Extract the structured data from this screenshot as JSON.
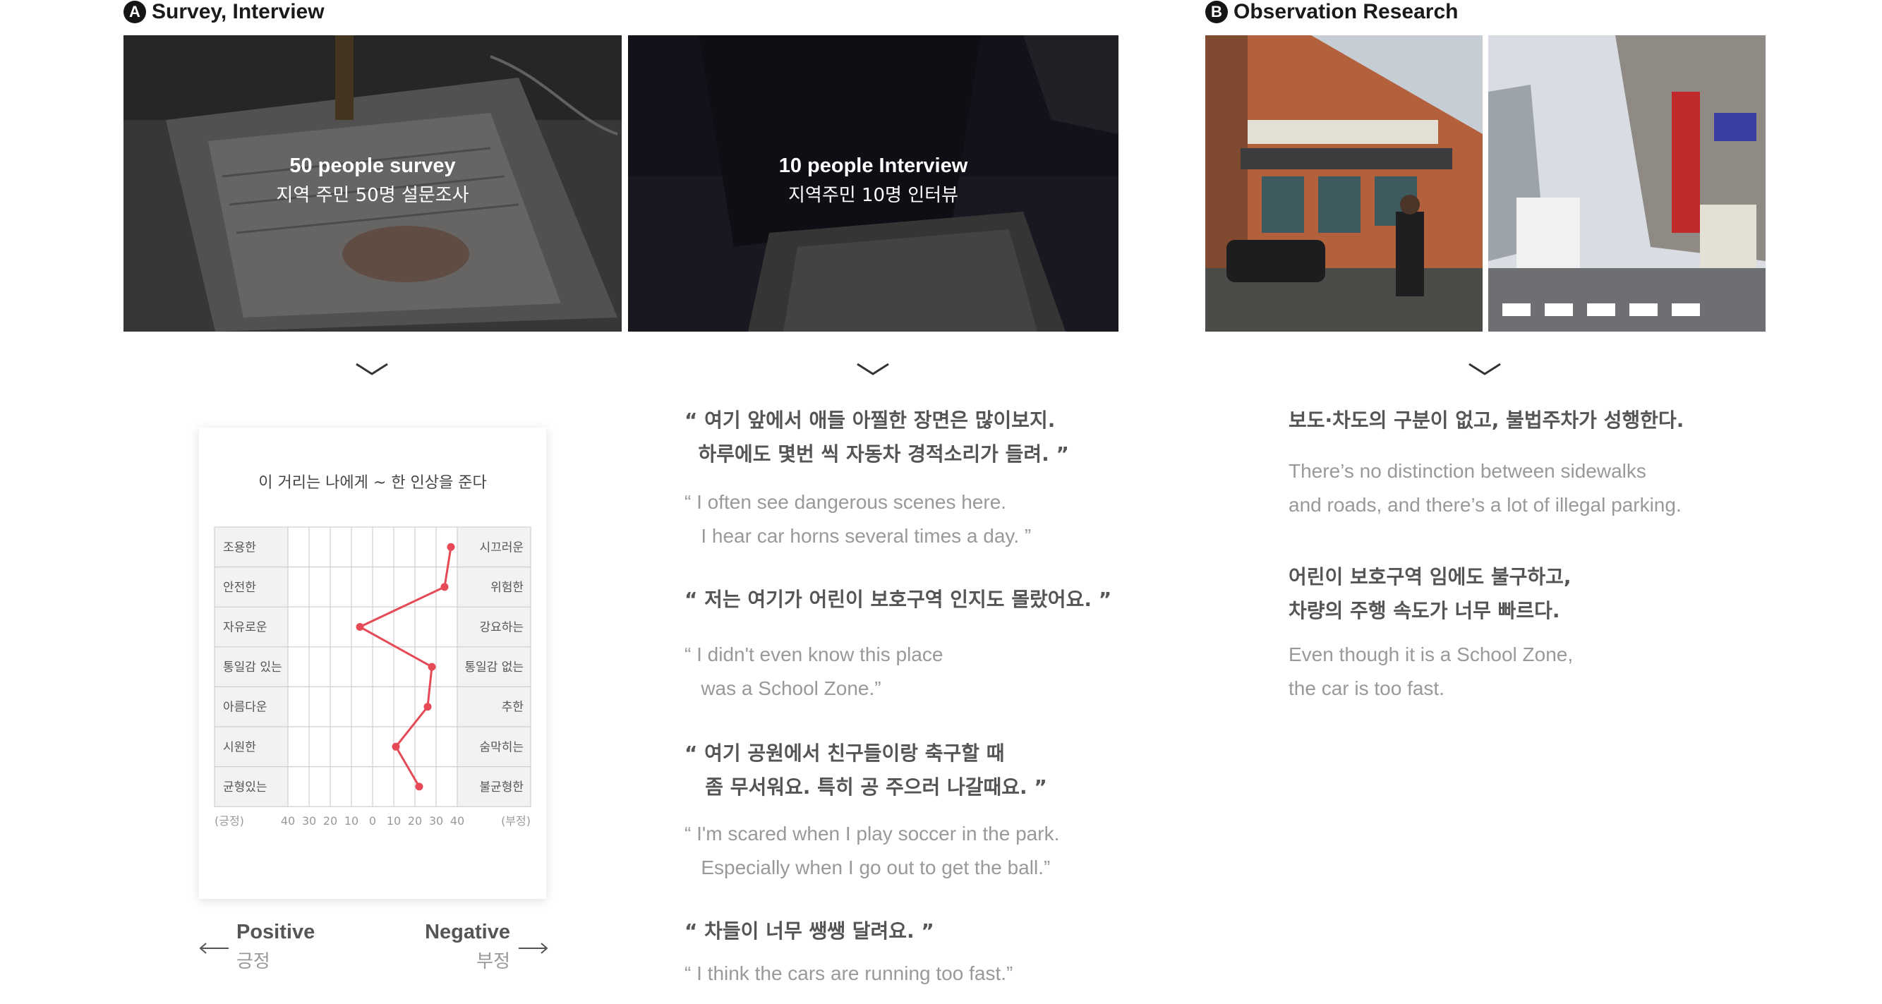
{
  "sections": {
    "a": {
      "badge": "A",
      "title": "Survey, Interview"
    },
    "b": {
      "badge": "B",
      "title": "Observation Research"
    }
  },
  "photos": {
    "survey": {
      "title": "50 people survey",
      "subtitle": "지역 주민 50명 설문조사"
    },
    "interview": {
      "title": "10 people Interview",
      "subtitle": "지역주민 10명 인터뷰"
    }
  },
  "chart_data": {
    "type": "line",
    "title": "이 거리는 나에게 ~ 한 인상을 준다",
    "left_labels": [
      "조용한",
      "안전한",
      "자유로운",
      "통일감 있는",
      "아름다운",
      "시원한",
      "균형있는"
    ],
    "right_labels": [
      "시끄러운",
      "위험한",
      "강요하는",
      "통일감 없는",
      "추한",
      "숨막히는",
      "불균형한"
    ],
    "x_ticks": [
      "40",
      "30",
      "20",
      "10",
      "0",
      "10",
      "20",
      "30",
      "40"
    ],
    "x_left_caption": "(긍정)",
    "x_right_caption": "(부정)",
    "xlim": [
      -40,
      40
    ],
    "values": [
      37,
      34,
      -6,
      28,
      26,
      11,
      22
    ],
    "color": "#e64a57"
  },
  "legend": {
    "positive_en": "Positive",
    "positive_ko": "긍정",
    "negative_en": "Negative",
    "negative_ko": "부정"
  },
  "quotes": [
    {
      "ko": "“ 여기 앞에서 애들 아찔한 장면은 많이보지.\n  하루에도 몇번 씩 자동차 경적소리가 들려. ”",
      "en": "“ I often see dangerous scenes here.\n   I hear car horns several times a day. ”"
    },
    {
      "ko": "“ 저는 여기가 어린이 보호구역 인지도 몰랐어요. ”",
      "en": "“ I didn't even know this place\n   was a School Zone.”"
    },
    {
      "ko": "“ 여기 공원에서 친구들이랑 축구할 때\n   좀 무서워요. 특히 공 주으러 나갈때요. ”",
      "en": "“ I'm scared when I play soccer in the park.\n   Especially when I go out to get the ball.”"
    },
    {
      "ko": "“ 차들이 너무 쌩쌩 달려요. ”",
      "en": "“ I think the cars are running too fast.”"
    }
  ],
  "observations": [
    {
      "ko": "보도·차도의 구분이 없고, 불법주차가 성행한다.",
      "en": "There’s no distinction between sidewalks\nand roads, and there’s a lot of illegal parking."
    },
    {
      "ko": "어린이 보호구역 임에도 불구하고,\n차량의 주행 속도가 너무 빠르다.",
      "en": "Even though it is a School Zone,\nthe car is too fast."
    }
  ]
}
